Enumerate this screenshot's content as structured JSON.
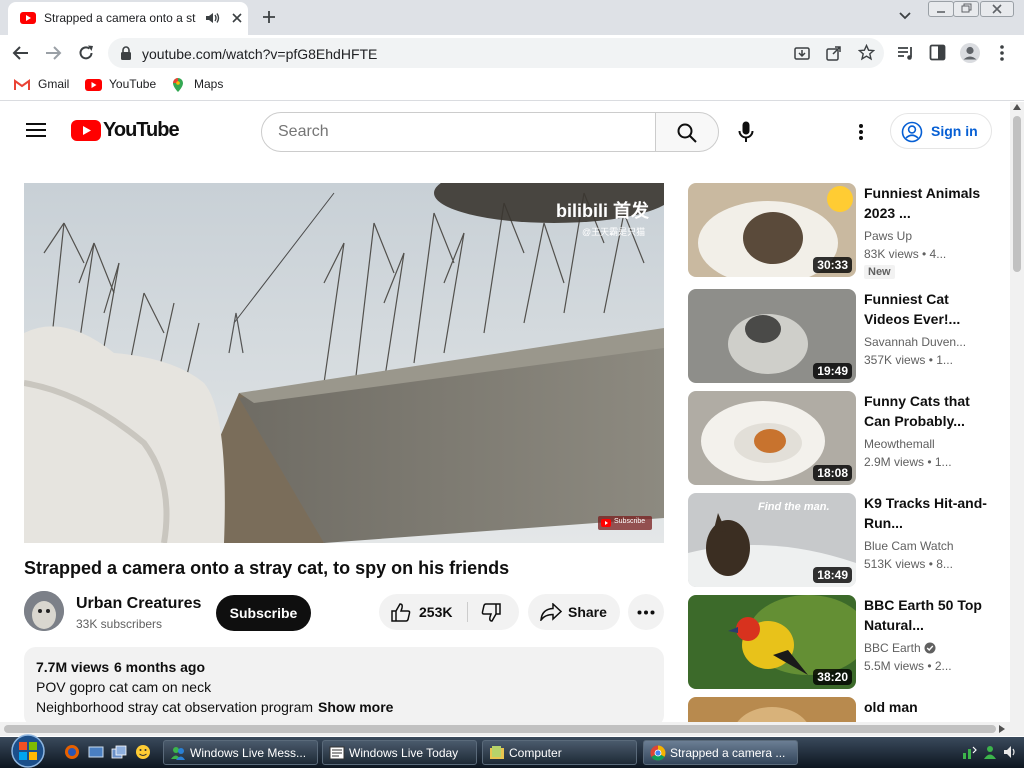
{
  "browser": {
    "tab_title": "Strapped a camera onto a stray cat, to spy on his friends - YouTube",
    "url": "youtube.com/watch?v=pfG8EhdHFTE",
    "bookmarks": [
      "Gmail",
      "YouTube",
      "Maps"
    ]
  },
  "youtube": {
    "logo_text": "YouTube",
    "search_placeholder": "Search",
    "signin_label": "Sign in"
  },
  "player": {
    "watermark_brand": "bilibili 首发",
    "watermark_handle": "@王天霸是只猫",
    "corner_badge": "Subscribe"
  },
  "video": {
    "title": "Strapped a camera onto a stray cat, to spy on his friends",
    "channel": "Urban Creatures",
    "subscribers": "33K subscribers",
    "subscribe_label": "Subscribe",
    "likes": "253K",
    "share_label": "Share",
    "views": "7.7M views",
    "age": "6 months ago",
    "description_line1": "POV gopro cat cam on neck",
    "description_line2": "Neighborhood stray cat observation program",
    "show_more": "Show more"
  },
  "recommendations": [
    {
      "title": "Funniest Animals 2023 ...",
      "channel": "Paws Up",
      "meta": "83K views  • 4...",
      "duration": "30:33",
      "badge": "New",
      "colors": [
        "#c9b9a0",
        "#f2efe8",
        "#5a4a3a"
      ]
    },
    {
      "title": "Funniest Cat Videos Ever!...",
      "channel": "Savannah Duven...",
      "meta": "357K views  • 1...",
      "duration": "19:49",
      "colors": [
        "#8e8e8a",
        "#cfcfca",
        "#4a4a48"
      ]
    },
    {
      "title": "Funny Cats that Can Probably...",
      "channel": "Meowthemall",
      "meta": "2.9M views  • 1...",
      "duration": "18:08",
      "colors": [
        "#b0aca4",
        "#f3f1ec",
        "#c8732e"
      ]
    },
    {
      "title": "K9 Tracks Hit-and-Run...",
      "channel": "Blue Cam Watch",
      "meta": "513K views  • 8...",
      "duration": "18:49",
      "overlay": "Find the man.",
      "colors": [
        "#c7c9cb",
        "#eef0f0",
        "#3b2e22"
      ]
    },
    {
      "title": "BBC Earth 50 Top Natural...",
      "channel": "BBC Earth",
      "meta": "5.5M views  • 2...",
      "duration": "38:20",
      "colors": [
        "#3c6a2a",
        "#7fa83c",
        "#e8c21a"
      ]
    },
    {
      "title": "old man",
      "channel": "",
      "meta": "",
      "duration": "",
      "colors": [
        "#b88a4e",
        "#d8b27a",
        "#8a6030"
      ]
    }
  ],
  "taskbar": {
    "tasks": [
      "Windows Live Mess...",
      "Windows Live Today",
      "Computer",
      "Strapped a camera ..."
    ]
  },
  "colors": {
    "youtube_red": "#ff0000",
    "link_blue": "#065fd4",
    "chrome_frame": "#dee1e6"
  }
}
